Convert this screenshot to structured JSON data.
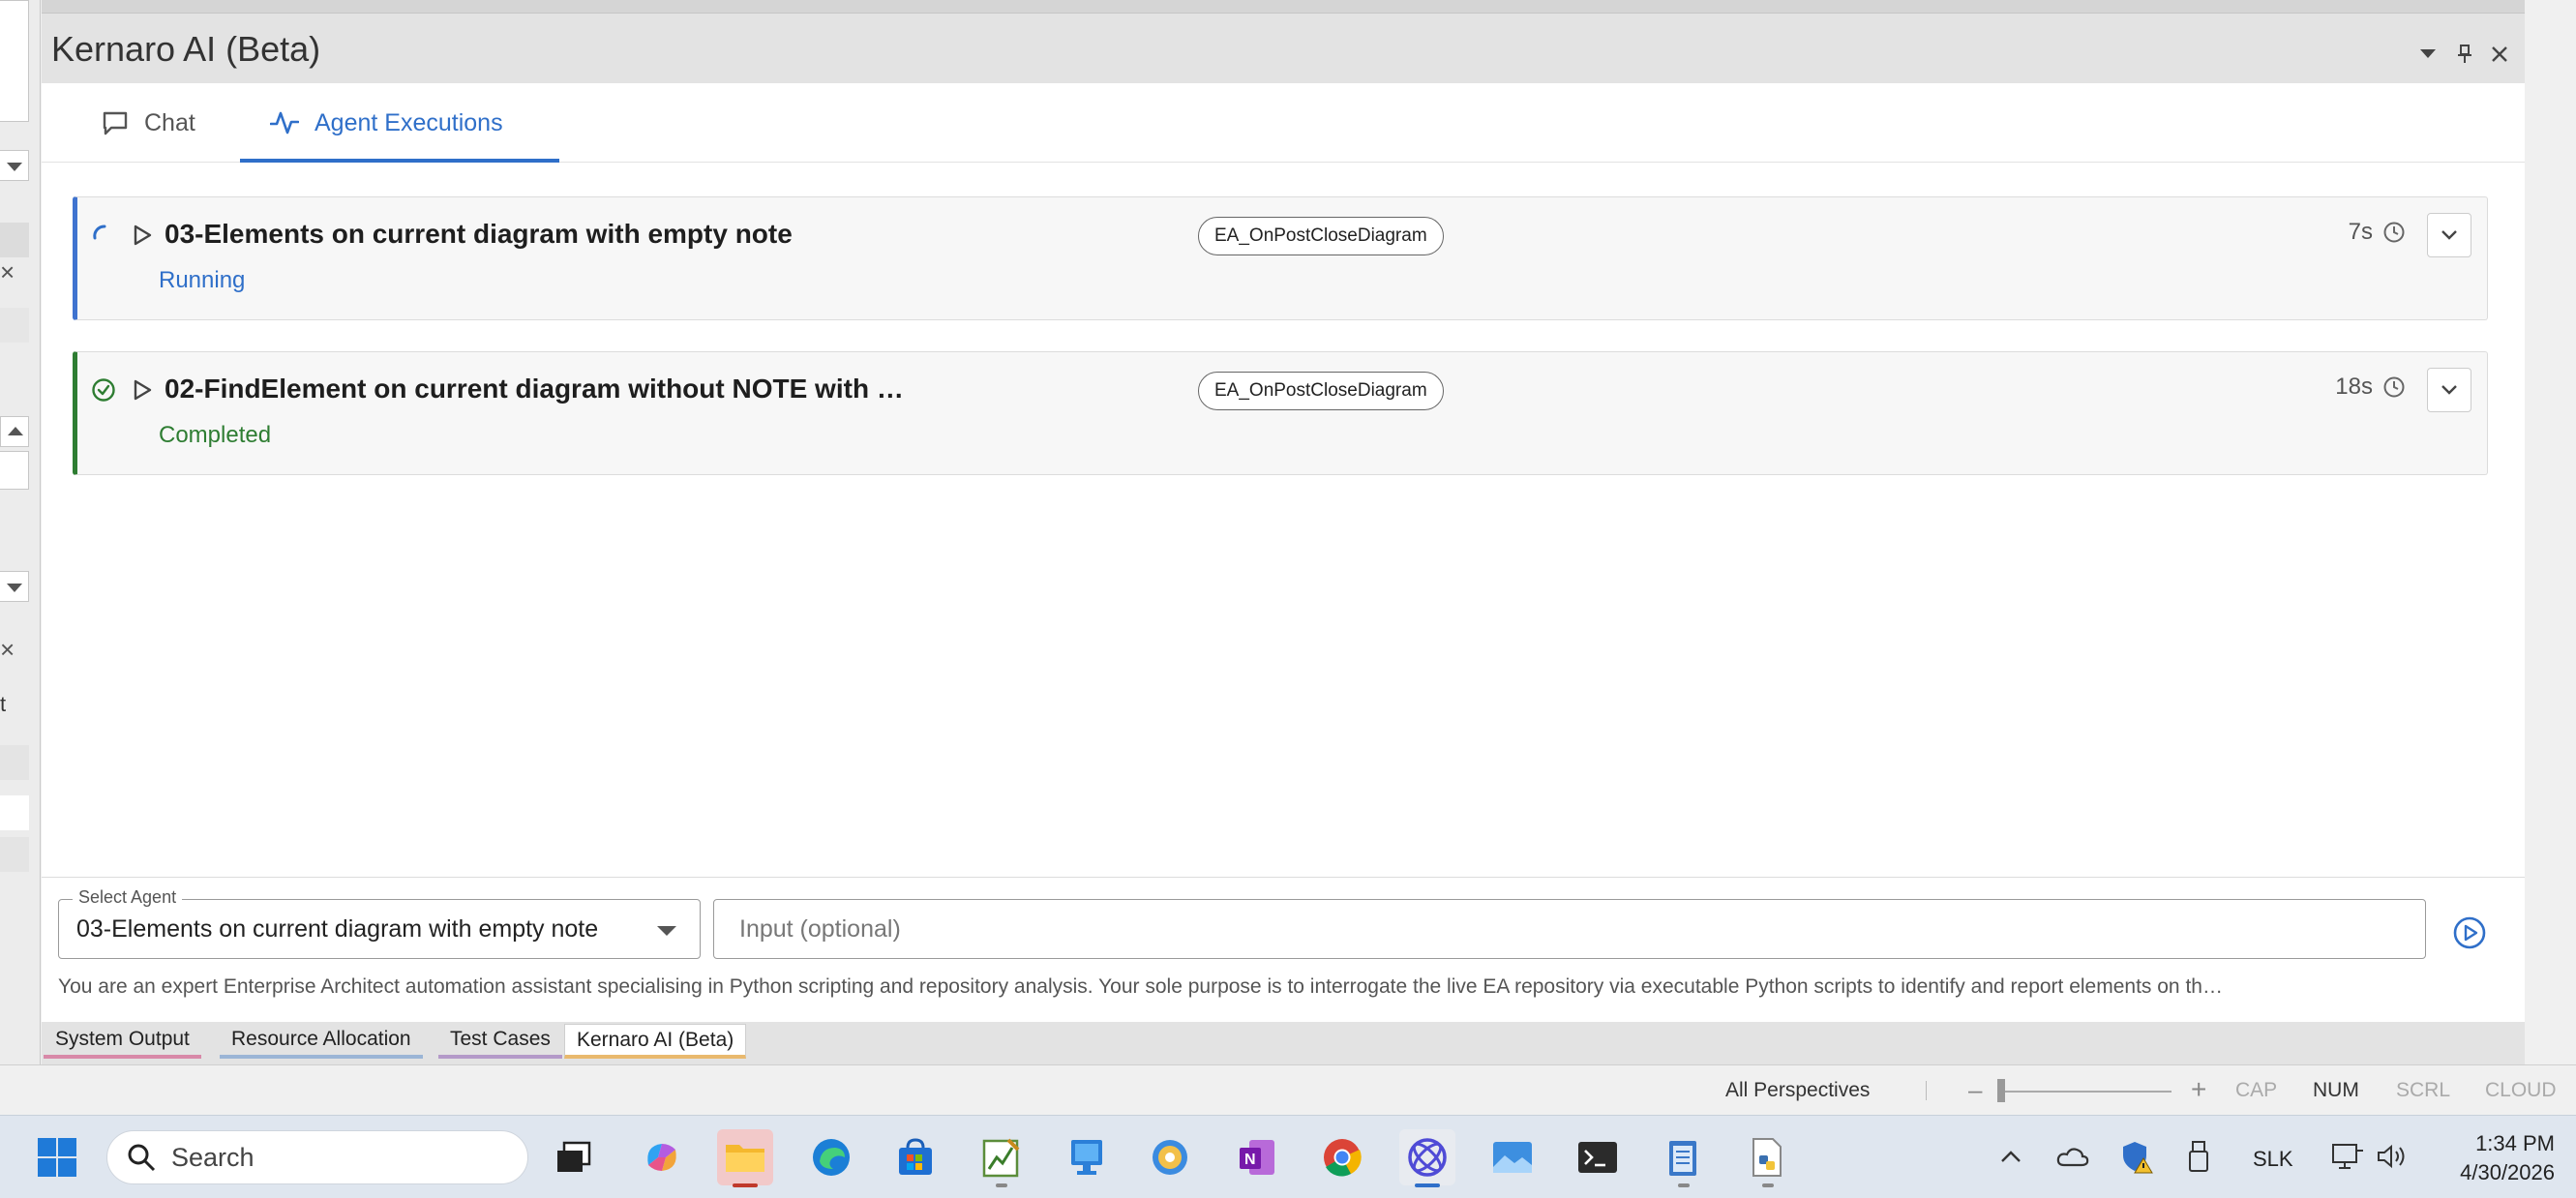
{
  "panel": {
    "title": "Kernaro AI (Beta)"
  },
  "tabs": [
    {
      "label": "Chat"
    },
    {
      "label": "Agent Executions"
    }
  ],
  "executions": [
    {
      "title": "03-Elements on current diagram with empty note",
      "status": "Running",
      "event": "EA_OnPostCloseDiagram",
      "duration": "7s"
    },
    {
      "title": "02-FindElement on current diagram without NOTE with …",
      "status": "Completed",
      "event": "EA_OnPostCloseDiagram",
      "duration": "18s"
    }
  ],
  "agent_select": {
    "label": "Select Agent",
    "value": "03-Elements on current diagram with empty note"
  },
  "input": {
    "placeholder": "Input (optional)"
  },
  "system_prompt": "You are an expert Enterprise Architect automation assistant specialising in Python scripting and repository analysis. Your sole purpose is to interrogate the live EA repository via executable Python scripts to identify and report elements on th…",
  "dock_tabs": [
    {
      "label": "System Output",
      "color": "#d889a8"
    },
    {
      "label": "Resource Allocation",
      "color": "#9bb5d6"
    },
    {
      "label": "Test Cases",
      "color": "#b49ac9"
    },
    {
      "label": "Kernaro AI (Beta)",
      "color": "#e9b96e"
    }
  ],
  "statusbar": {
    "perspective": "All Perspectives",
    "zoom_minus": "–",
    "zoom_plus": "+",
    "cap": "CAP",
    "num": "NUM",
    "scrl": "SCRL",
    "cloud": "CLOUD"
  },
  "left_panel": {
    "fragment": "t"
  },
  "taskbar": {
    "search_label": "Search",
    "tray_lang": "SLK",
    "time": "1:34 PM",
    "date": "4/30/2026"
  },
  "colors": {
    "accent": "#2f6fc9",
    "running": "#2f6fc9",
    "completed": "#2e7d32"
  }
}
